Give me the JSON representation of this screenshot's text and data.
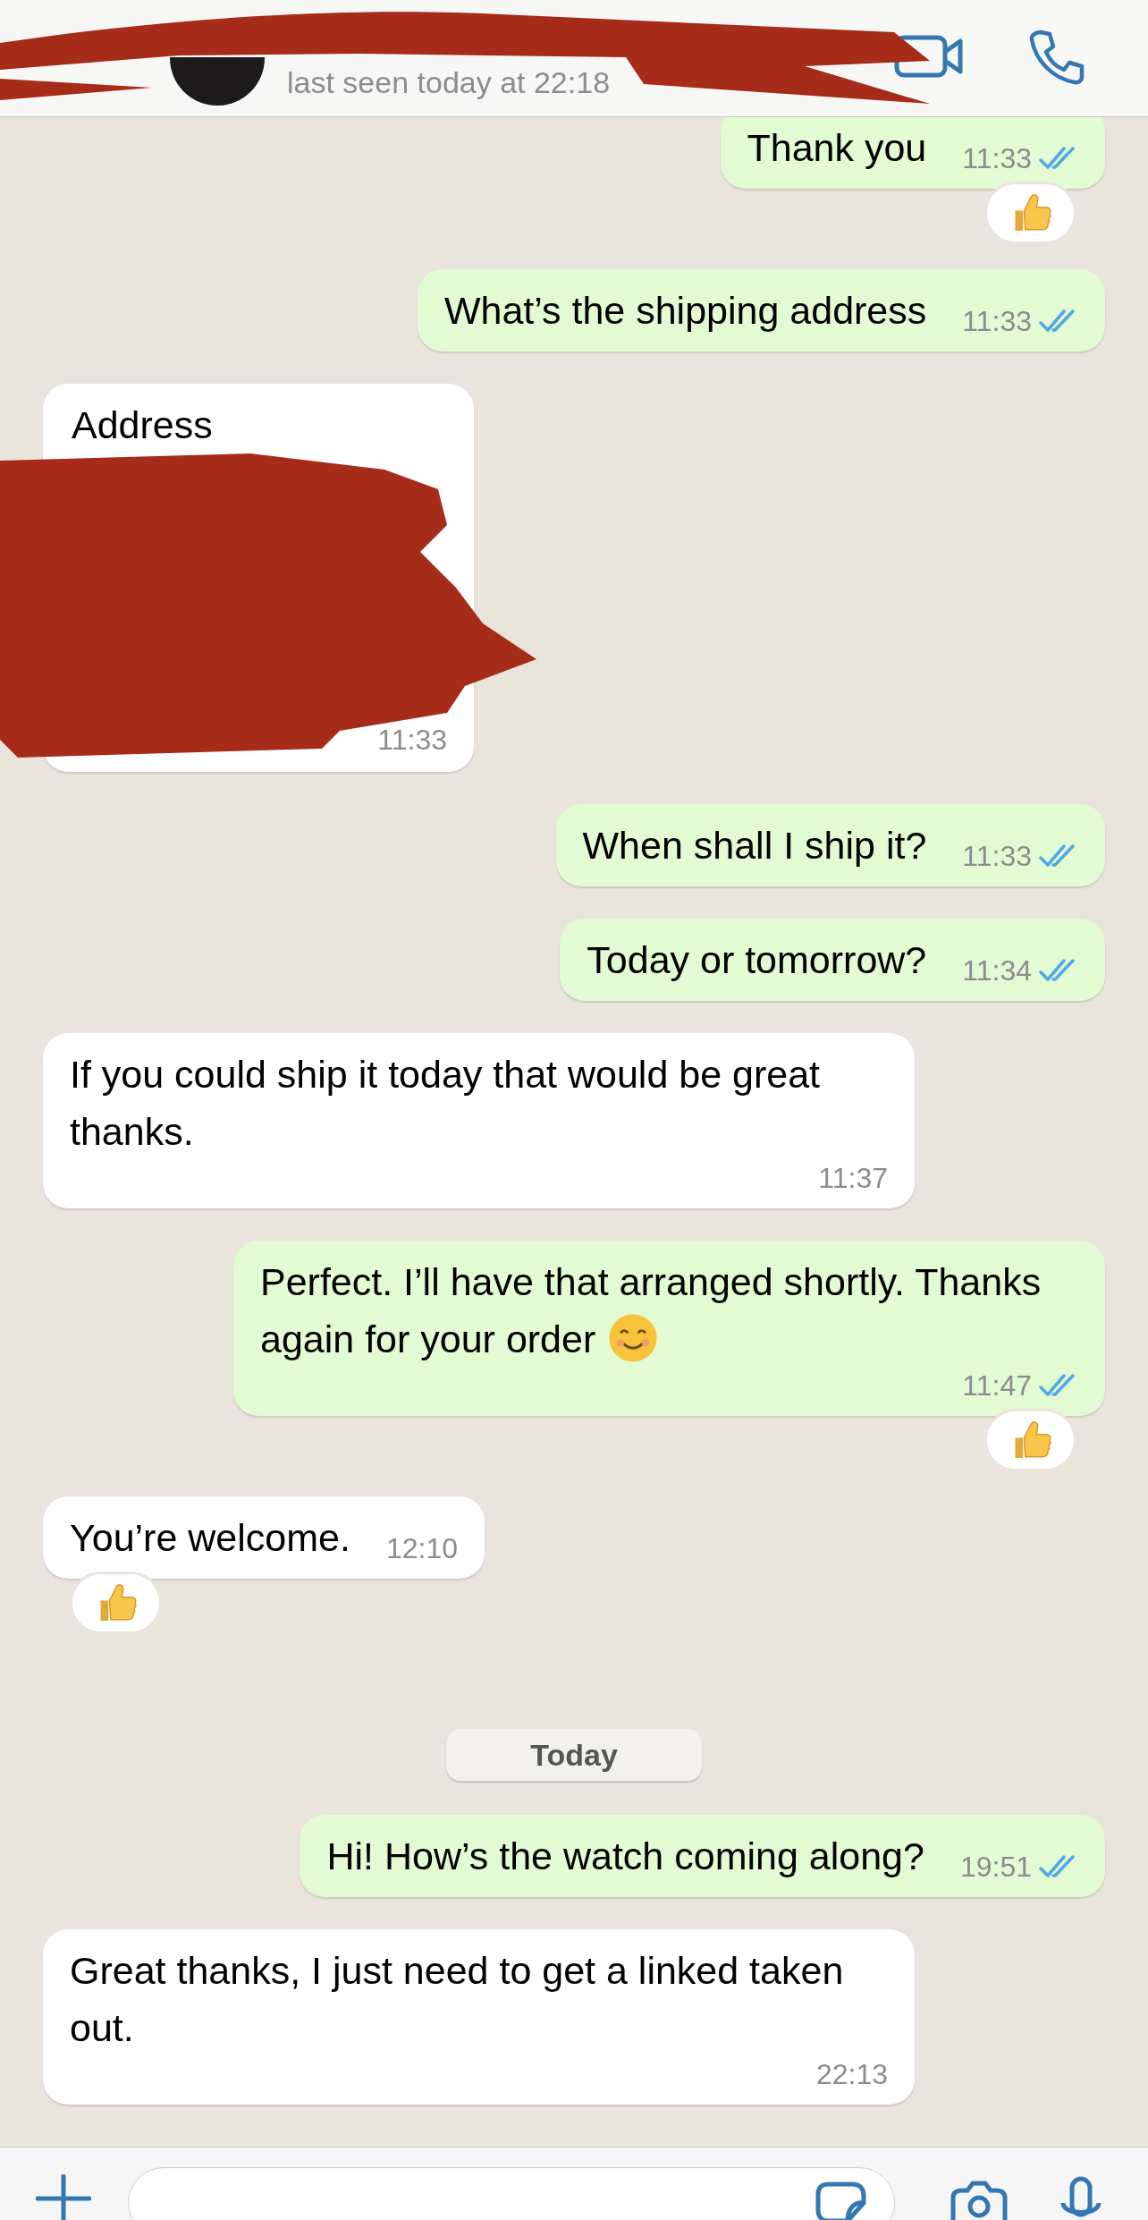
{
  "header": {
    "status": "last seen today at 22:18"
  },
  "messages": [
    {
      "kind": "text",
      "outgoing": true,
      "text": "Thank you",
      "time": "11:33",
      "read": true,
      "thumbs_up_reaction": true
    },
    {
      "kind": "text",
      "outgoing": true,
      "text": "What’s the shipping address",
      "time": "11:33",
      "read": true,
      "thumbs_up_reaction": false
    },
    {
      "kind": "redacted",
      "outgoing": false,
      "text": "Address",
      "time": "11:33",
      "thumbs_up_reaction": false
    },
    {
      "kind": "text",
      "outgoing": true,
      "text": "When shall I ship it?",
      "time": "11:33",
      "read": true,
      "thumbs_up_reaction": false
    },
    {
      "kind": "text",
      "outgoing": true,
      "text": "Today or tomorrow?",
      "time": "11:34",
      "read": true,
      "thumbs_up_reaction": false
    },
    {
      "kind": "text",
      "outgoing": false,
      "text": "If you could ship it today that would be great thanks.",
      "time": "11:37",
      "thumbs_up_reaction": false
    },
    {
      "kind": "text",
      "outgoing": true,
      "text": "Perfect. I’ll have that arranged shortly. Thanks again for your order",
      "smiley": true,
      "time": "11:47",
      "read": true,
      "thumbs_up_reaction": true
    },
    {
      "kind": "text",
      "outgoing": false,
      "text": "You’re welcome.",
      "time": "12:10",
      "thumbs_up_reaction": true
    },
    {
      "kind": "date",
      "text": "Today"
    },
    {
      "kind": "text",
      "outgoing": true,
      "text": "Hi! How’s the watch coming along?",
      "time": "19:51",
      "read": true,
      "thumbs_up_reaction": false
    },
    {
      "kind": "text",
      "outgoing": false,
      "text": "Great thanks, I just need to get a linked taken out.",
      "time": "22:13",
      "thumbs_up_reaction": false
    }
  ]
}
